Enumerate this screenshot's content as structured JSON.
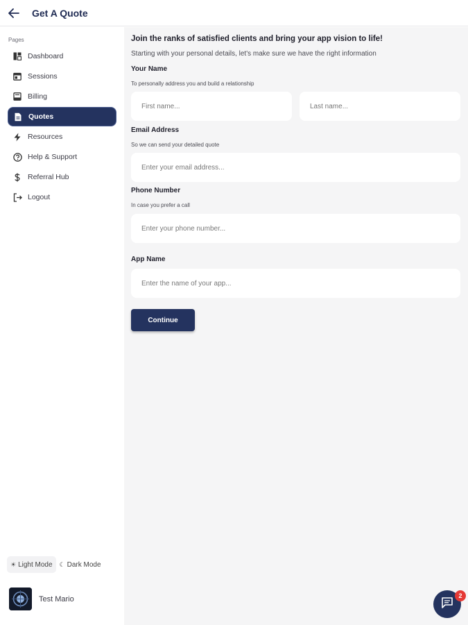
{
  "header": {
    "title": "Get A Quote"
  },
  "sidebar": {
    "section_label": "Pages",
    "items": [
      {
        "label": "Dashboard",
        "icon": "dashboard-icon"
      },
      {
        "label": "Sessions",
        "icon": "calendar-icon"
      },
      {
        "label": "Billing",
        "icon": "receipt-icon"
      },
      {
        "label": "Quotes",
        "icon": "document-icon",
        "active": true
      },
      {
        "label": "Resources",
        "icon": "lightning-icon"
      },
      {
        "label": "Help & Support",
        "icon": "help-icon"
      },
      {
        "label": "Referral Hub",
        "icon": "dollar-icon"
      },
      {
        "label": "Logout",
        "icon": "logout-icon"
      }
    ],
    "mode": {
      "light_label": "Light Mode",
      "dark_label": "Dark Mode",
      "selected": "Light Mode"
    },
    "user": {
      "name": "Test Mario"
    }
  },
  "form": {
    "headline": "Join the ranks of satisfied clients and bring your app vision to life!",
    "subline": "Starting with your personal details, let's make sure we have the right information",
    "name": {
      "label": "Your Name",
      "hint": "To personally address you and build a relationship",
      "first_placeholder": "First name...",
      "last_placeholder": "Last name..."
    },
    "email": {
      "label": "Email Address",
      "hint": "So we can send your detailed quote",
      "placeholder": "Enter your email address..."
    },
    "phone": {
      "label": "Phone Number",
      "hint": "In case you prefer a call",
      "placeholder": "Enter your phone number..."
    },
    "app": {
      "label": "App Name",
      "placeholder": "Enter the name of your app..."
    },
    "continue_label": "Continue"
  },
  "chat": {
    "badge_count": "2"
  },
  "colors": {
    "accent": "#24335f",
    "background": "#f5f5f6",
    "badge": "#e53935"
  }
}
